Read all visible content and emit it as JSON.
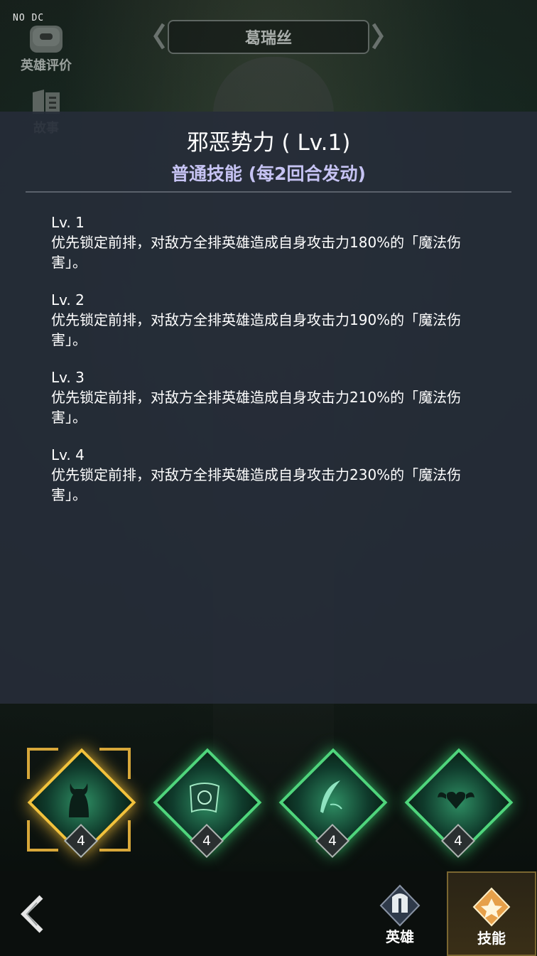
{
  "debug_text": "NO DC",
  "sidebar": {
    "rating": {
      "label": "英雄评价",
      "icon": "speech-bubble-icon"
    },
    "story": {
      "label": "故事",
      "icon": "book-icon"
    }
  },
  "header": {
    "hero_name": "葛瑞丝"
  },
  "skill_panel": {
    "name": "邪恶势力 ( Lv.1)",
    "subtitle": "普通技能 (每2回合发动)",
    "levels": [
      {
        "level": "Lv. 1",
        "description": "优先锁定前排，对敌方全排英雄造成自身攻击力180%的「魔法伤害」。"
      },
      {
        "level": "Lv. 2",
        "description": "优先锁定前排，对敌方全排英雄造成自身攻击力190%的「魔法伤害」。"
      },
      {
        "level": "Lv. 3",
        "description": "优先锁定前排，对敌方全排英雄造成自身攻击力210%的「魔法伤害」。"
      },
      {
        "level": "Lv. 4",
        "description": "优先锁定前排，对敌方全排英雄造成自身攻击力230%的「魔法伤害」。"
      }
    ]
  },
  "skills": [
    {
      "icon": "demon-silhouette-icon",
      "level": "4",
      "selected": true
    },
    {
      "icon": "magic-scroll-icon",
      "level": "4",
      "selected": false
    },
    {
      "icon": "feather-quill-icon",
      "level": "4",
      "selected": false
    },
    {
      "icon": "winged-heart-icon",
      "level": "4",
      "selected": false
    }
  ],
  "bottom_nav": {
    "back_icon": "back-arrow-icon",
    "tabs": [
      {
        "label": "英雄",
        "icon": "helmet-icon",
        "active": false
      },
      {
        "label": "技能",
        "icon": "skill-badge-icon",
        "active": true
      }
    ]
  },
  "colors": {
    "accent_subtitle": "#c6c3f3",
    "skill_glow": "#4fd57c",
    "selected_gold": "#f2c23c"
  }
}
